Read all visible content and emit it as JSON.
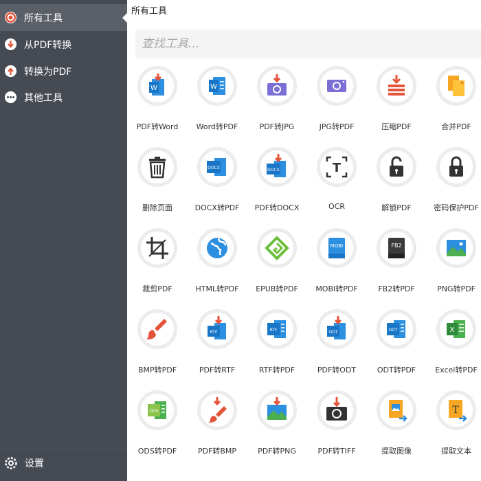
{
  "sidebar": {
    "items": [
      {
        "label": "所有工具",
        "icon": "target-icon",
        "active": true
      },
      {
        "label": "从PDF转换",
        "icon": "arrow-down-icon"
      },
      {
        "label": "转换为PDF",
        "icon": "arrow-up-icon"
      },
      {
        "label": "其他工具",
        "icon": "more-icon"
      }
    ],
    "settings_label": "设置"
  },
  "main": {
    "title": "所有工具",
    "search_placeholder": "查找工具..."
  },
  "tools": [
    {
      "label": "PDF转Word",
      "icon": "pdf-to-word-icon"
    },
    {
      "label": "Word转PDF",
      "icon": "word-to-pdf-icon"
    },
    {
      "label": "PDF转JPG",
      "icon": "pdf-to-jpg-icon"
    },
    {
      "label": "JPG转PDF",
      "icon": "jpg-to-pdf-icon"
    },
    {
      "label": "压缩PDF",
      "icon": "compress-icon"
    },
    {
      "label": "合并PDF",
      "icon": "merge-icon"
    },
    {
      "label": "删除页面",
      "icon": "trash-icon"
    },
    {
      "label": "DOCX转PDF",
      "icon": "docx-to-pdf-icon"
    },
    {
      "label": "PDF转DOCX",
      "icon": "pdf-to-docx-icon"
    },
    {
      "label": "OCR",
      "icon": "ocr-icon"
    },
    {
      "label": "解锁PDF",
      "icon": "unlock-icon"
    },
    {
      "label": "密码保护PDF",
      "icon": "lock-icon"
    },
    {
      "label": "裁剪PDF",
      "icon": "crop-icon"
    },
    {
      "label": "HTML转PDF",
      "icon": "globe-icon"
    },
    {
      "label": "EPUB转PDF",
      "icon": "epub-icon"
    },
    {
      "label": "MOBI转PDF",
      "icon": "mobi-icon"
    },
    {
      "label": "FB2转PDF",
      "icon": "fb2-icon"
    },
    {
      "label": "PNG转PDF",
      "icon": "png-icon"
    },
    {
      "label": "BMP转PDF",
      "icon": "brush-icon"
    },
    {
      "label": "PDF转RTF",
      "icon": "pdf-to-rtf-icon"
    },
    {
      "label": "RTF转PDF",
      "icon": "rtf-to-pdf-icon"
    },
    {
      "label": "PDF转ODT",
      "icon": "pdf-to-odt-icon"
    },
    {
      "label": "ODT转PDF",
      "icon": "odt-to-pdf-icon"
    },
    {
      "label": "Excel转PDF",
      "icon": "excel-icon"
    },
    {
      "label": "ODS转PDF",
      "icon": "ods-icon"
    },
    {
      "label": "PDF转BMP",
      "icon": "pdf-to-bmp-icon"
    },
    {
      "label": "PDF转PNG",
      "icon": "pdf-to-png-icon"
    },
    {
      "label": "PDF转TIFF",
      "icon": "pdf-to-tiff-icon"
    },
    {
      "label": "提取图像",
      "icon": "extract-image-icon"
    },
    {
      "label": "提取文本",
      "icon": "extract-text-icon"
    }
  ],
  "icon_text": {
    "docx": "DOCX",
    "mobi": "MOBI",
    "fb2": "FB2",
    "rtf": "RTF",
    "odt": "ODT",
    "ods": "ODS",
    "excel": "X",
    "w": "W",
    "t": "T"
  },
  "colors": {
    "sidebar_bg": "#454a53",
    "sidebar_active": "#5b6068",
    "accent_red": "#e4543a",
    "blue": "#2d8fe0",
    "purple": "#7b6fd6",
    "green": "#4caf50",
    "orange": "#f5a623"
  }
}
